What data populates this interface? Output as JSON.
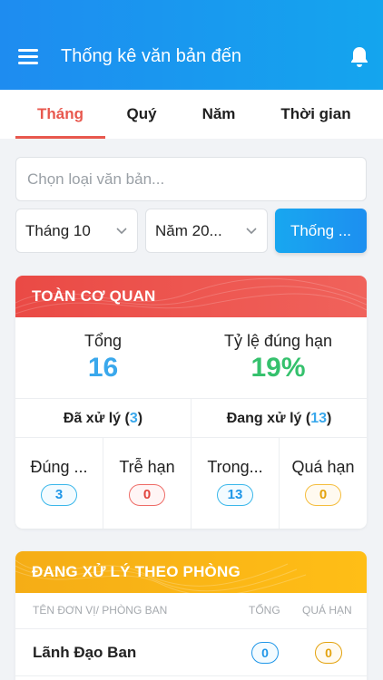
{
  "header": {
    "title": "Thống kê văn bản đến"
  },
  "tabs": [
    {
      "label": "Tháng",
      "active": true
    },
    {
      "label": "Quý",
      "active": false
    },
    {
      "label": "Năm",
      "active": false
    },
    {
      "label": "Thời gian",
      "active": false
    }
  ],
  "filters": {
    "doc_type_placeholder": "Chọn loại văn bản...",
    "month_value": "Tháng 10",
    "year_value": "Năm 20...",
    "submit_label": "Thống ..."
  },
  "overview": {
    "title": "TOÀN CƠ QUAN",
    "total_label": "Tổng",
    "total_value": "16",
    "ontime_rate_label": "Tỷ lệ đúng hạn",
    "ontime_rate_value": "19%",
    "processed_label": "Đã xử lý",
    "processed_count": "3",
    "processing_label": "Đang xử lý",
    "processing_count": "13",
    "ontime_label": "Đúng ...",
    "ontime_value": "3",
    "late_label": "Trễ hạn",
    "late_value": "0",
    "within_label": "Trong...",
    "within_value": "13",
    "overdue_label": "Quá hạn",
    "overdue_value": "0"
  },
  "department": {
    "title": "ĐANG XỬ LÝ THEO PHÒNG",
    "col_unit": "TÊN ĐƠN VỊ/ PHÒNG BAN",
    "col_total": "TỔNG",
    "col_overdue": "QUÁ HẠN",
    "rows": [
      {
        "name": "Lãnh Đạo Ban",
        "total": "0",
        "overdue": "0"
      }
    ]
  },
  "colors": {
    "primary": "#1e8cf0",
    "active_tab": "#e8584e",
    "overview_header": "#ea4a45",
    "department_header": "#f5ad16",
    "total_number": "#3aa8ec",
    "rate_number": "#35c16d"
  },
  "icons": {
    "menu": "menu-icon",
    "bell": "bell-icon",
    "chevron": "chevron-down-icon"
  }
}
